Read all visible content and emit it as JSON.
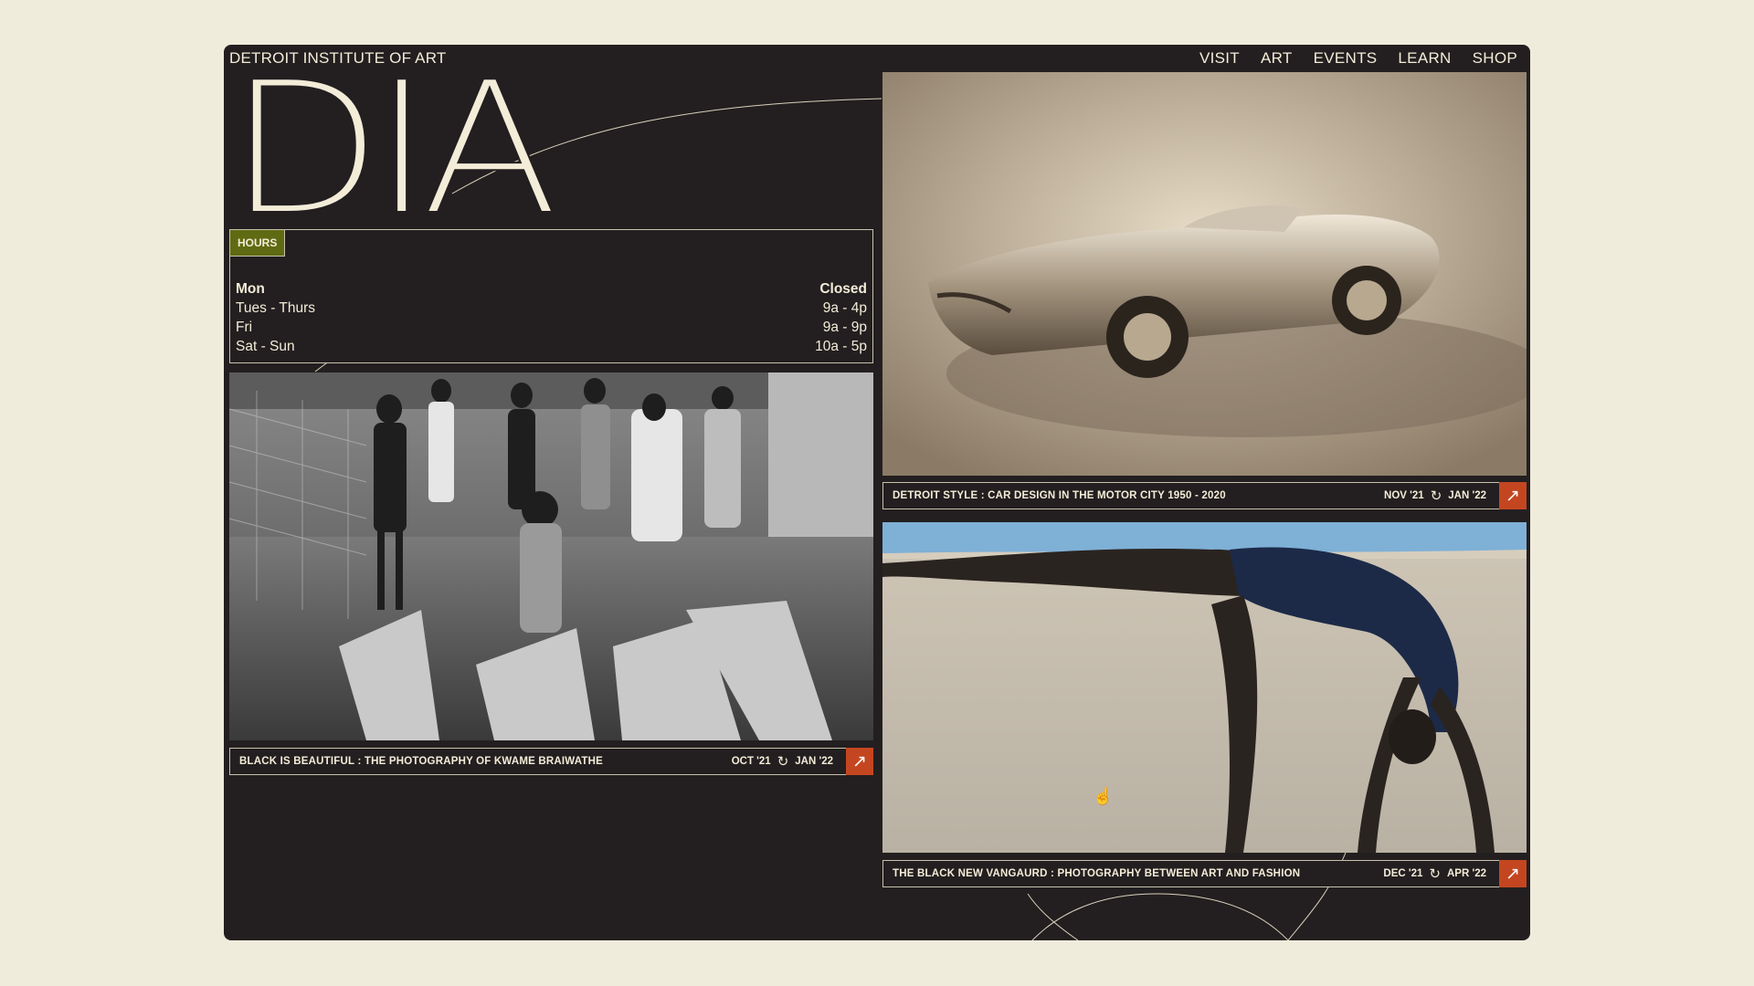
{
  "site": {
    "name": "DETROIT INSTITUTE OF ART",
    "logo": "DIA"
  },
  "nav": [
    "VISIT",
    "ART",
    "EVENTS",
    "LEARN",
    "SHOP"
  ],
  "hours": {
    "badge": "HOURS",
    "rows": [
      {
        "day": "Mon",
        "time": "Closed"
      },
      {
        "day": "Tues - Thurs",
        "time": "9a - 4p"
      },
      {
        "day": "Fri",
        "time": "9a - 9p"
      },
      {
        "day": "Sat - Sun",
        "time": "10a - 5p"
      }
    ]
  },
  "exhibitions": [
    {
      "title": "Black is Beautiful :  The Photography of Kwame Braiwathe",
      "start": "OCT '21",
      "end": "JAN '22"
    },
    {
      "title": "Detroit Style : Car Design in the Motor City 1950 - 2020",
      "start": "NOV '21",
      "end": "JAN '22"
    },
    {
      "title": "The Black New Vangaurd : Photography Between Art and Fashion",
      "start": "DEC '21",
      "end": "APR '22"
    }
  ],
  "icons": {
    "arrow": "arrow-up-right-icon",
    "cycle": "cycle-icon",
    "cursor": "hand-cursor-icon"
  },
  "colors": {
    "page_bg": "#f0ecdc",
    "window_bg": "#231f20",
    "text": "#f3ecd8",
    "hours_badge": "#5f6b12",
    "accent": "#c44621"
  }
}
